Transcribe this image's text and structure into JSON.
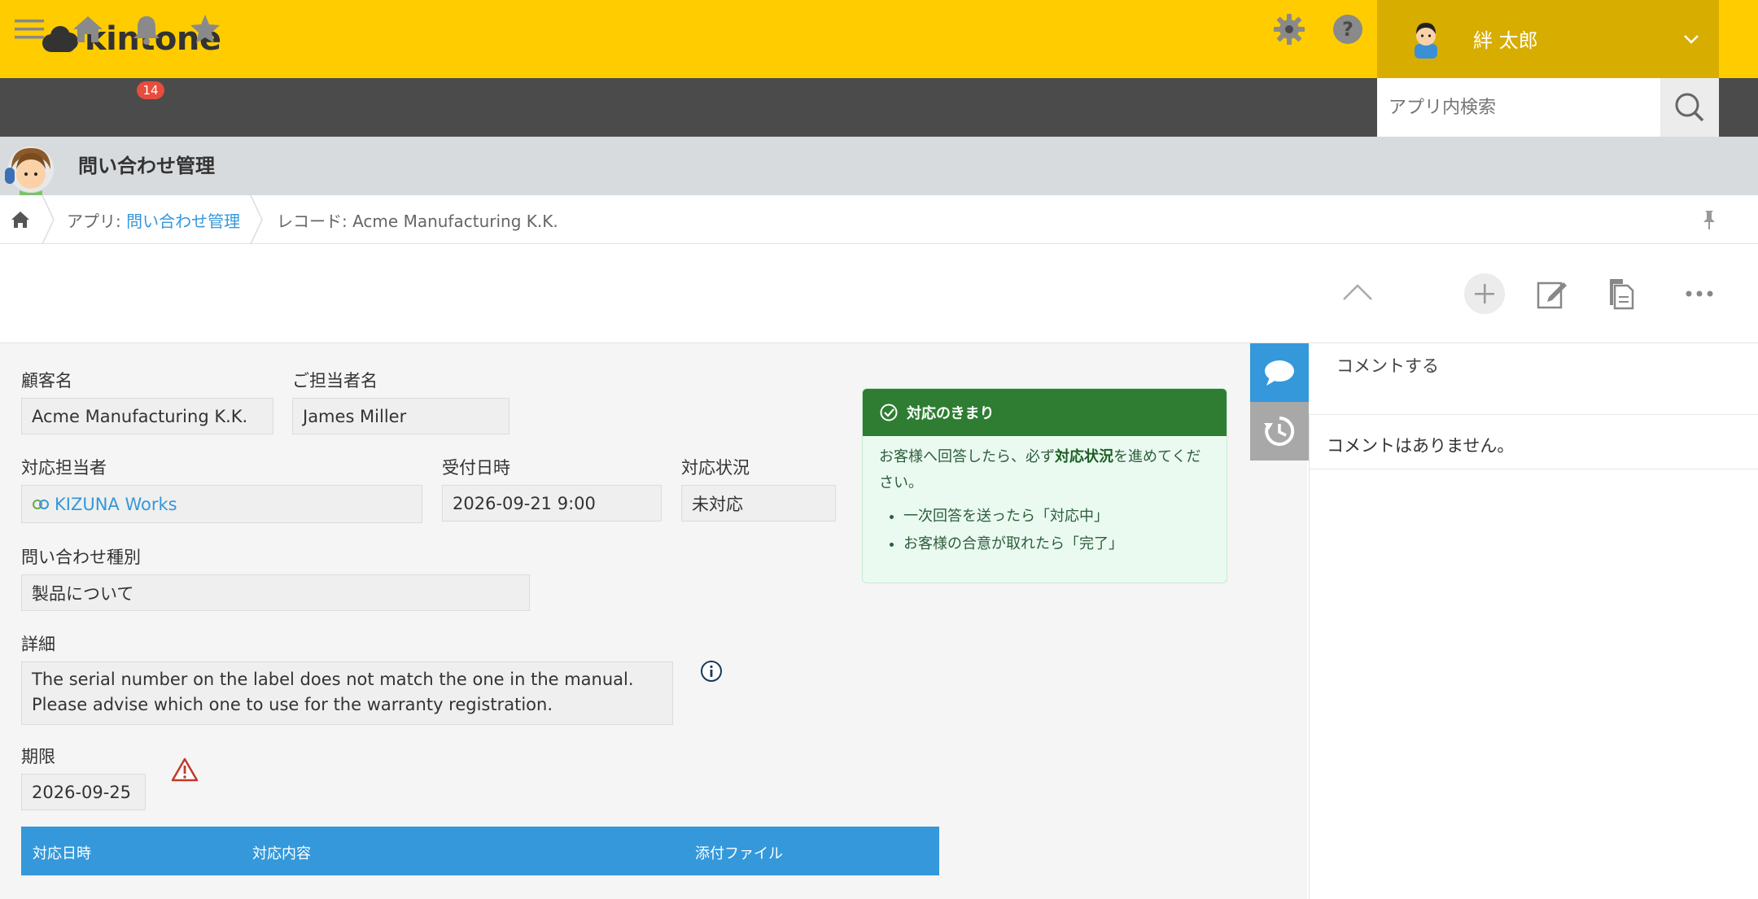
{
  "header": {
    "logo_text": "kintone",
    "user_name": "絆 太郎"
  },
  "nav": {
    "notification_count": "14",
    "search_placeholder": "アプリ内検索"
  },
  "app": {
    "title": "問い合わせ管理"
  },
  "breadcrumb": {
    "app_prefix": "アプリ: ",
    "app_link": "問い合わせ管理",
    "record_text": "レコード: Acme Manufacturing K.K."
  },
  "record": {
    "customer_label": "顧客名",
    "customer_value": "Acme Manufacturing K.K.",
    "contact_label": "ご担当者名",
    "contact_value": "James Miller",
    "assignee_label": "対応担当者",
    "assignee_value": "KIZUNA Works",
    "received_label": "受付日時",
    "received_value": "2026-09-21 9:00",
    "status_label": "対応状況",
    "status_value": "未対応",
    "category_label": "問い合わせ種別",
    "category_value": "製品について",
    "detail_label": "詳細",
    "detail_line1": "The serial number on the label does not match the one in the manual.",
    "detail_line2": "Please advise which one to use for the warranty registration.",
    "deadline_label": "期限",
    "deadline_value": "2026-09-25"
  },
  "guide": {
    "title": "対応のきまり",
    "text_before": "お客様へ回答したら、必ず",
    "text_bold": "対応状況",
    "text_after": "を進めてください。",
    "items": [
      "一次回答を送ったら「対応中」",
      "お客様の合意が取れたら「完了」"
    ]
  },
  "subtable": {
    "columns": [
      "対応日時",
      "対応内容",
      "添付ファイル"
    ]
  },
  "comments": {
    "placeholder": "コメントする",
    "empty_text": "コメントはありません。"
  },
  "colors": {
    "header_yellow": "#ffcc00",
    "user_box": "#d7ad00",
    "nav_dark": "#4b4b4b",
    "link_blue": "#3498db",
    "guide_green": "#2e7d32"
  }
}
